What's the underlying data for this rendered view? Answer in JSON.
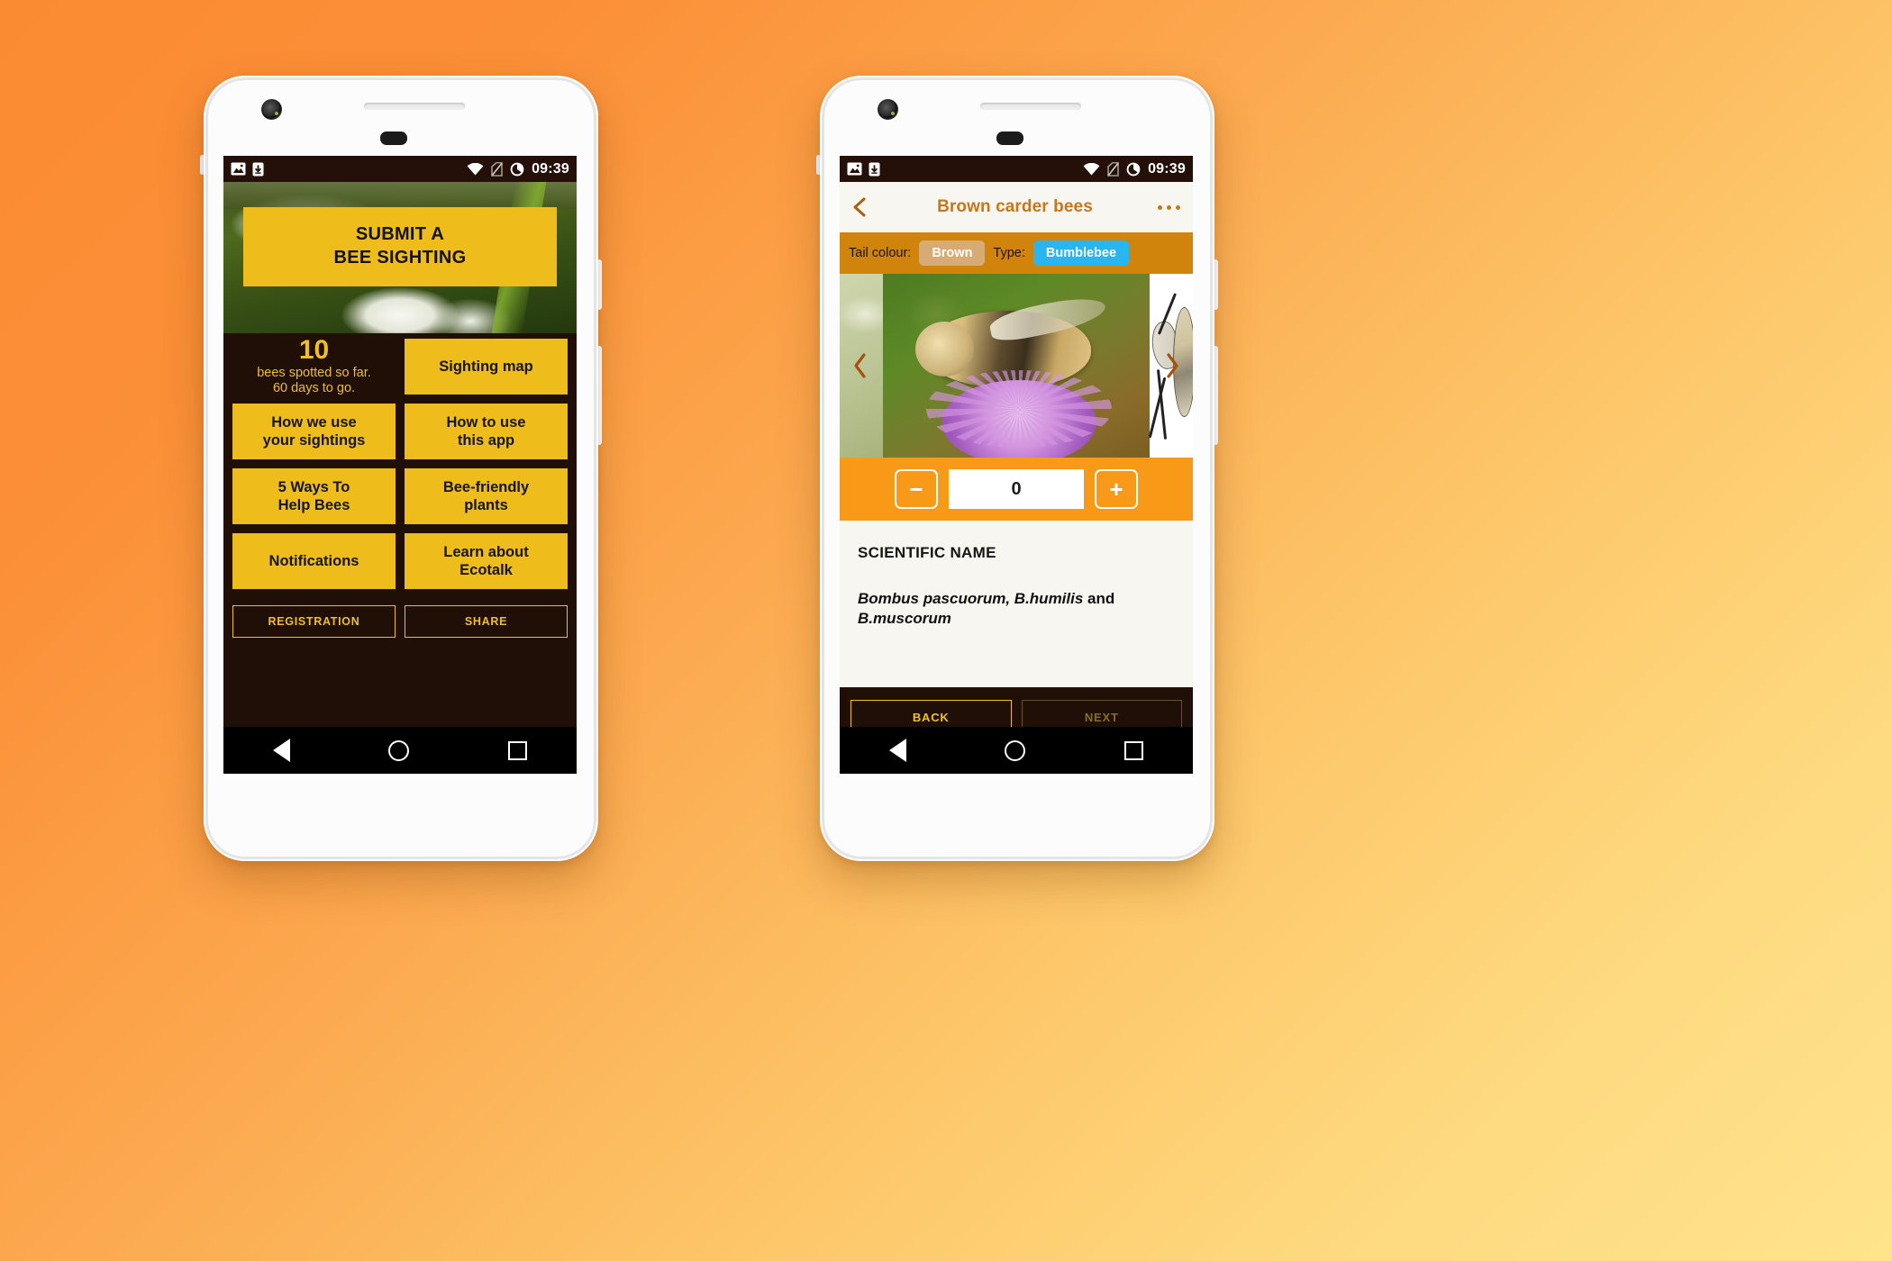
{
  "status_bar": {
    "time": "09:39",
    "icons_left": [
      "image-icon",
      "download-icon"
    ],
    "icons_right": [
      "wifi-icon",
      "sim-off-icon",
      "sync-icon"
    ]
  },
  "colors": {
    "amber": "#efbd1b",
    "dark_brown": "#1f0f07",
    "status_brown": "#241008",
    "orange_accent": "#f89a17",
    "filter_bar": "#d1840c",
    "title_orange": "#c8761a",
    "chip_brown": "#d9ab74",
    "chip_blue": "#29b6f0",
    "panel_cream": "#f7f6f1"
  },
  "left_phone": {
    "hero": {
      "submit_line1": "SUBMIT A",
      "submit_line2": "BEE SIGHTING"
    },
    "stats": {
      "count": "10",
      "line1": "bees spotted so far.",
      "line2": "60 days to go."
    },
    "tiles": [
      {
        "label": "Sighting map",
        "name": "sighting-map"
      },
      {
        "label_line1": "How we use",
        "label_line2": "your sightings",
        "name": "how-we-use-your-sightings"
      },
      {
        "label_line1": "How to use",
        "label_line2": "this app",
        "name": "how-to-use-this-app"
      },
      {
        "label_line1": "5 Ways To",
        "label_line2": "Help Bees",
        "name": "5-ways-to-help-bees"
      },
      {
        "label_line1": "Bee-friendly",
        "label_line2": "plants",
        "name": "bee-friendly-plants"
      },
      {
        "label": "Notifications",
        "name": "notifications"
      },
      {
        "label_line1": "Learn about",
        "label_line2": "Ecotalk",
        "name": "learn-about-ecotalk"
      }
    ],
    "outline_buttons": [
      {
        "label": "REGISTRATION"
      },
      {
        "label": "SHARE"
      }
    ]
  },
  "right_phone": {
    "appbar": {
      "title": "Brown carder bees",
      "back_icon": "chevron-left-icon",
      "overflow_icon": "more-horizontal-icon"
    },
    "filters": {
      "tail_colour_label": "Tail colour:",
      "tail_colour_value": "Brown",
      "type_label": "Type:",
      "type_value": "Bumblebee"
    },
    "carousel": {
      "prev_icon": "chevron-left-icon",
      "next_icon": "chevron-right-icon",
      "slide_main": "bee-on-purple-flower-photo",
      "slide_next": "bee-line-drawing"
    },
    "counter": {
      "decrement_label": "−",
      "value": "0",
      "increment_label": "+"
    },
    "info": {
      "label": "SCIENTIFIC NAME",
      "italic_part": "Bombus pascuorum, B.humilis",
      "plain_part": " and",
      "italic_part2": "B.muscorum"
    },
    "footer": {
      "back_label": "BACK",
      "next_label": "NEXT"
    }
  },
  "nav_bar": {
    "back": "triangle-back-icon",
    "home": "circle-home-icon",
    "recents": "square-recents-icon"
  }
}
